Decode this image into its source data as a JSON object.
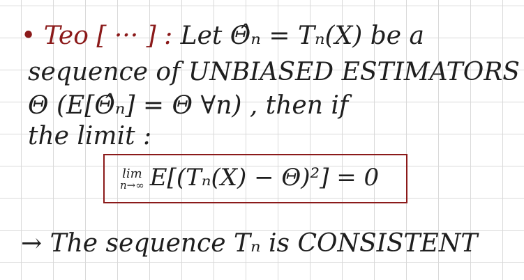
{
  "note": {
    "bullet": "•",
    "teo_label": "Teo [ ··· ] :",
    "line1_rest": "Let Θ̂ₙ = Tₙ(X) be a",
    "line2": "sequence of UNBIASED ESTIMATORS of",
    "line3": "Θ  (E[Θ̂ₙ] = Θ  ∀n) , then if",
    "line4": "the limit :",
    "formula_lim": "lim",
    "formula_sub": "n→∞",
    "formula_body": "E[(Tₙ(X) − Θ)²] = 0",
    "conclusion": "→ The sequence Tₙ is CONSISTENT"
  },
  "colors": {
    "ink": "#1e1e1e",
    "accent": "#8b1a1a",
    "grid": "#d9d9d9",
    "paper": "#ffffff"
  }
}
